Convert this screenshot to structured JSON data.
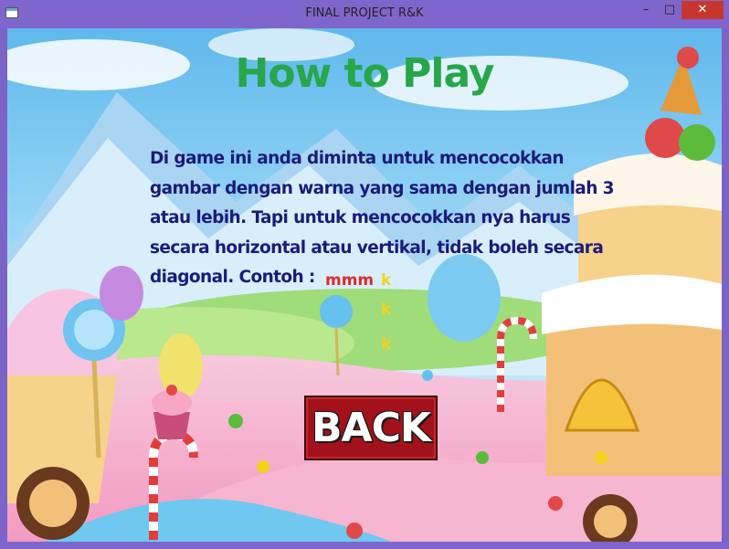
{
  "window": {
    "title": "FINAL PROJECT R&K",
    "minimize_glyph": "–",
    "maximize_glyph": "□",
    "close_glyph": "✕"
  },
  "screen": {
    "heading": "How to Play",
    "instructions": "Di game ini anda diminta untuk mencocokkan gambar dengan warna yang sama dengan jumlah 3 atau lebih. Tapi untuk mencocokkan nya harus secara horizontal atau vertikal, tidak boleh secara diagonal. Contoh :",
    "example": {
      "horizontal": "mmm",
      "vertical": [
        "k",
        "k",
        "k"
      ],
      "horizontal_color": "#e02a2a",
      "vertical_color": "#f2d21b"
    },
    "back_button": "BACK"
  },
  "colors": {
    "frame": "#7f66cc",
    "heading": "#27a64b",
    "instructions": "#1b1b7a",
    "back_button": "#a3121a",
    "close_button": "#c7372f"
  },
  "icons": {
    "window_icon": "app-window-icon",
    "minimize": "minimize-icon",
    "maximize": "maximize-icon",
    "close": "close-icon"
  }
}
